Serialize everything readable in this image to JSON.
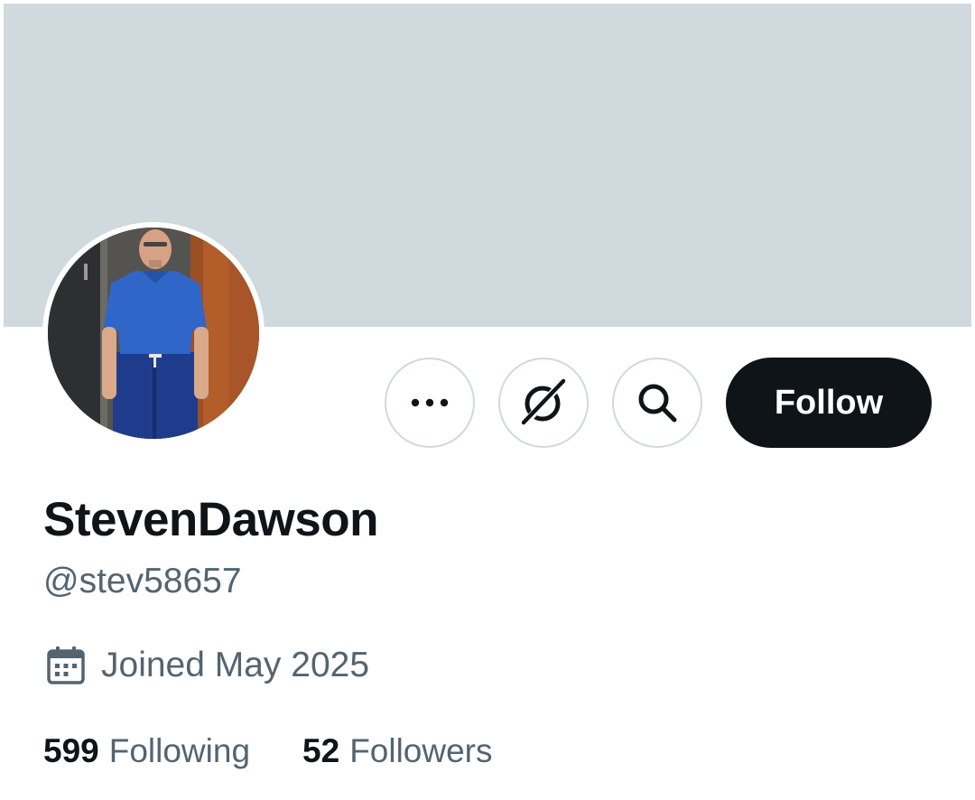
{
  "profile": {
    "display_name": "StevenDawson",
    "handle": "@stev58657",
    "joined": "Joined May 2025",
    "banner_color": "#cfd9de"
  },
  "actions": {
    "more_icon": "more-horizontal-icon",
    "grok_icon": "grok-icon",
    "search_icon": "search-icon",
    "follow_label": "Follow"
  },
  "stats": {
    "following_count": "599",
    "following_label": "Following",
    "followers_count": "52",
    "followers_label": "Followers"
  },
  "colors": {
    "text_primary": "#0f1419",
    "text_secondary": "#536471",
    "border": "#cfd9de",
    "follow_bg": "#0f1419"
  }
}
